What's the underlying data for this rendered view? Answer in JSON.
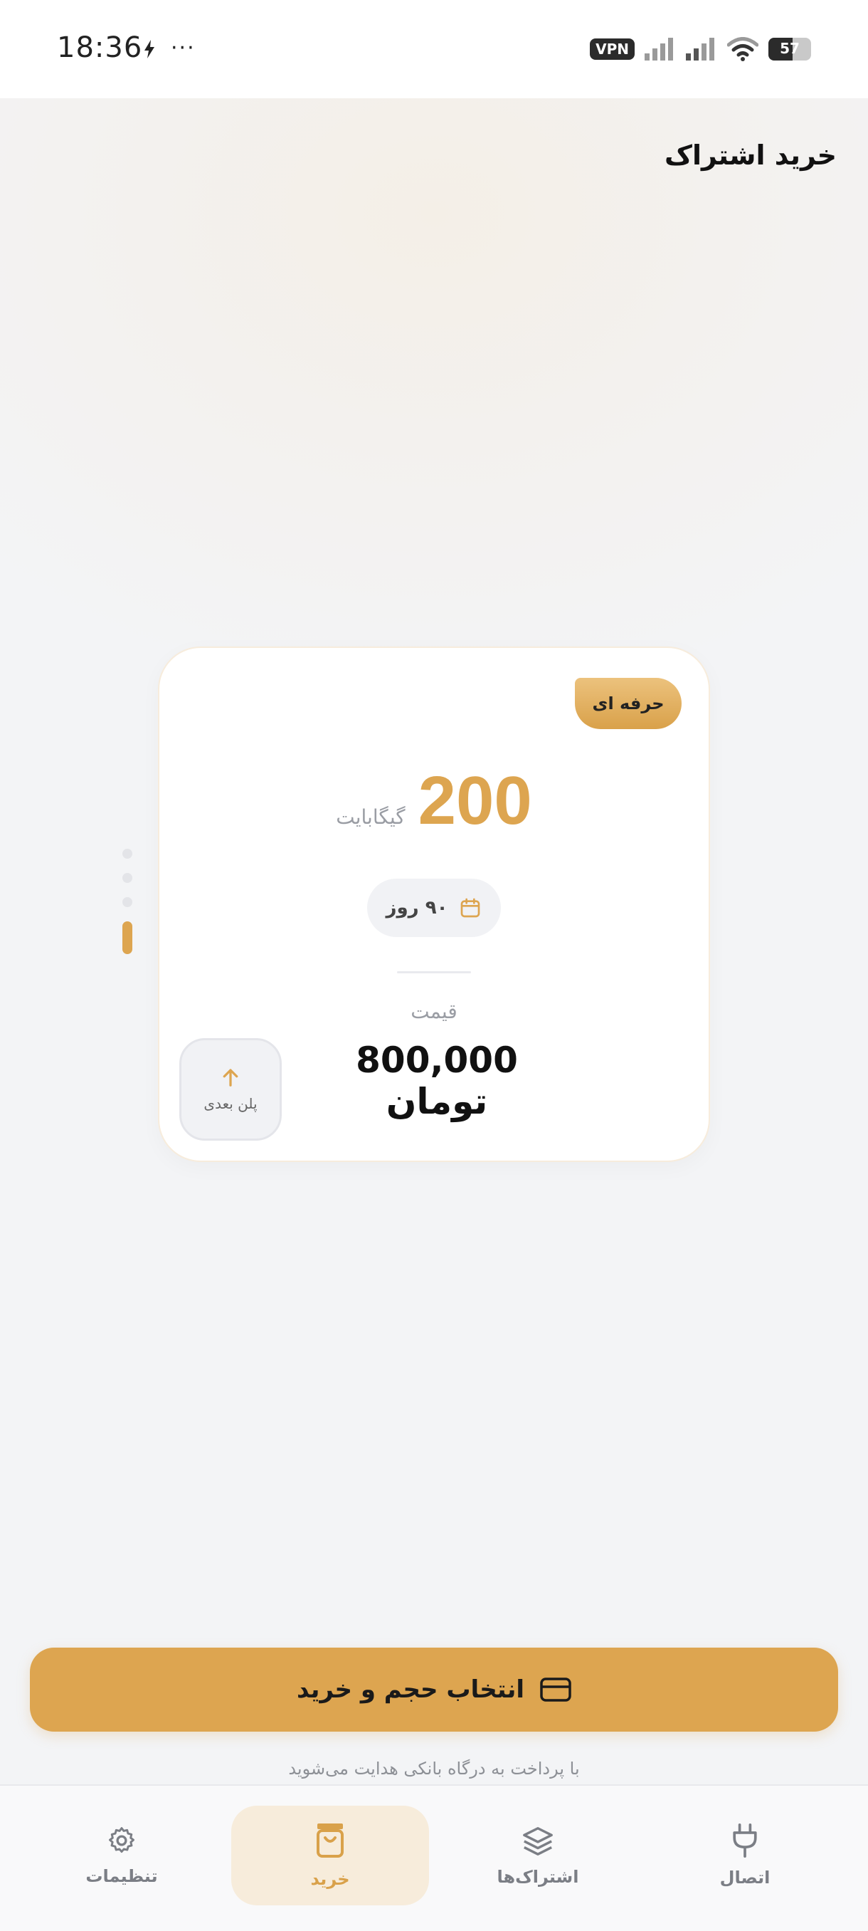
{
  "status_bar": {
    "time": "18:36",
    "more": "···",
    "vpn": "VPN",
    "battery": "57"
  },
  "header": {
    "title": "خرید اشتراک"
  },
  "carousel": {
    "dot_count": 4,
    "active_index": 3
  },
  "plan_card": {
    "tier": "حرفه ای",
    "volume": "200",
    "volume_unit": "گیگابایت",
    "duration": "۹۰ روز",
    "price_label": "قیمت",
    "price": "800,000 تومان",
    "next_plan_label": "پلن بعدی"
  },
  "cta": {
    "label": "انتخاب حجم و خرید",
    "note": "با پرداخت به درگاه بانکی هدایت می‌شوید"
  },
  "bottom_nav": {
    "items": [
      {
        "label": "تنظیمات",
        "icon": "gear-icon",
        "active": false
      },
      {
        "label": "خرید",
        "icon": "shopping-bag-icon",
        "active": true
      },
      {
        "label": "اشتراک‌ها",
        "icon": "layers-icon",
        "active": false
      },
      {
        "label": "اتصال",
        "icon": "plug-icon",
        "active": false
      }
    ]
  },
  "colors": {
    "accent": "#dda550",
    "accent_light": "#f7ecdb",
    "text_dark": "#111111",
    "text_muted": "#9a9da4"
  }
}
